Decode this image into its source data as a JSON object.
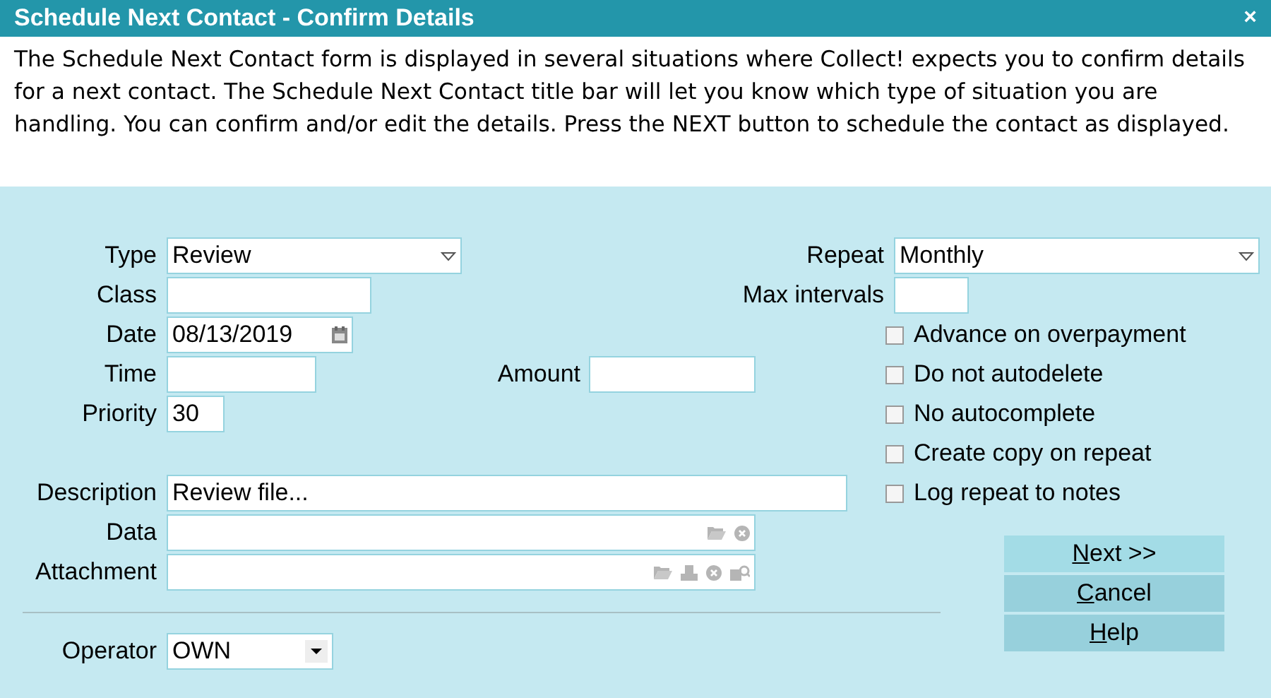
{
  "window": {
    "title": "Schedule Next Contact - Confirm Details",
    "close": "×"
  },
  "help_text": "The Schedule Next Contact form is displayed in several situations where Collect! expects you to confirm details for a next contact. The Schedule Next Contact title bar will let you know which type of situation you are handling. You can confirm and/or edit the details. Press the NEXT button to schedule the contact as displayed.",
  "fields": {
    "type": {
      "label": "Type",
      "value": "Review"
    },
    "class": {
      "label": "Class"
    },
    "date": {
      "label": "Date",
      "value": "08/13/2019"
    },
    "time": {
      "label": "Time"
    },
    "amount": {
      "label": "Amount"
    },
    "priority": {
      "label": "Priority",
      "value": "30"
    },
    "description": {
      "label": "Description",
      "value": "Review file..."
    },
    "data": {
      "label": "Data"
    },
    "attachment": {
      "label": "Attachment"
    },
    "operator": {
      "label": "Operator",
      "value": "OWN"
    },
    "repeat": {
      "label": "Repeat",
      "value": "Monthly"
    },
    "max_intervals": {
      "label": "Max intervals"
    }
  },
  "options": [
    {
      "label": "Advance on overpayment",
      "checked": false
    },
    {
      "label": "Do not autodelete",
      "checked": false
    },
    {
      "label": "No autocomplete",
      "checked": false
    },
    {
      "label": "Create copy on repeat",
      "checked": false
    },
    {
      "label": "Log repeat to notes",
      "checked": false
    }
  ],
  "buttons": [
    {
      "accel": "N",
      "rest": "ext >>",
      "selected": true
    },
    {
      "accel": "C",
      "rest": "ancel",
      "selected": false
    },
    {
      "accel": "H",
      "rest": "elp",
      "selected": false
    }
  ]
}
